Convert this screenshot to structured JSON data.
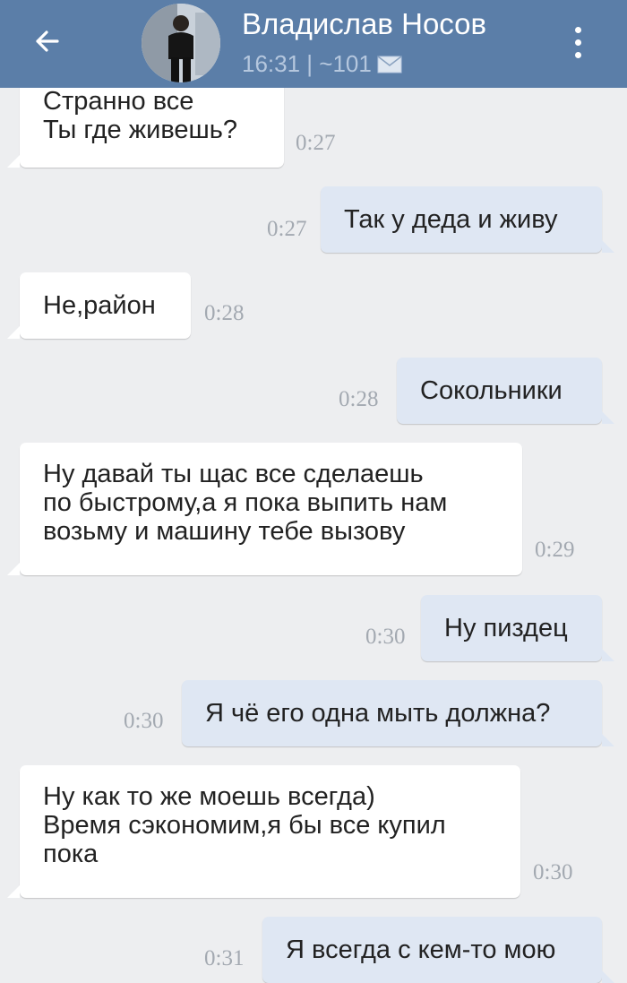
{
  "header": {
    "contact_name": "Владислав Носов",
    "status": "16:31 | ~101",
    "back_icon": "arrow-left-icon",
    "mail_icon": "envelope-icon",
    "menu_icon": "more-vertical-icon",
    "header_color": "#5b7ea8"
  },
  "messages": [
    {
      "direction": "incoming",
      "lines": [
        "Странно все",
        "Ты где живешь?"
      ],
      "time": "0:27"
    },
    {
      "direction": "outgoing",
      "lines": [
        "Так у деда и живу"
      ],
      "time": "0:27"
    },
    {
      "direction": "incoming",
      "lines": [
        "Не,район"
      ],
      "time": "0:28"
    },
    {
      "direction": "outgoing",
      "lines": [
        "Сокольники"
      ],
      "time": "0:28"
    },
    {
      "direction": "incoming",
      "lines": [
        "Ну давай ты щас все сделаешь",
        "по быстрому,а я пока выпить нам",
        "возьму и машину тебе вызову"
      ],
      "time": "0:29"
    },
    {
      "direction": "outgoing",
      "lines": [
        "Ну пиздец"
      ],
      "time": "0:30"
    },
    {
      "direction": "outgoing",
      "lines": [
        "Я чё его одна мыть должна?"
      ],
      "time": "0:30"
    },
    {
      "direction": "incoming",
      "lines": [
        "Ну как то же моешь всегда)",
        "Время сэкономим,я бы все купил",
        "пока"
      ],
      "time": "0:30"
    },
    {
      "direction": "outgoing",
      "lines": [
        "Я всегда с кем-то мою"
      ],
      "time": "0:31"
    }
  ]
}
